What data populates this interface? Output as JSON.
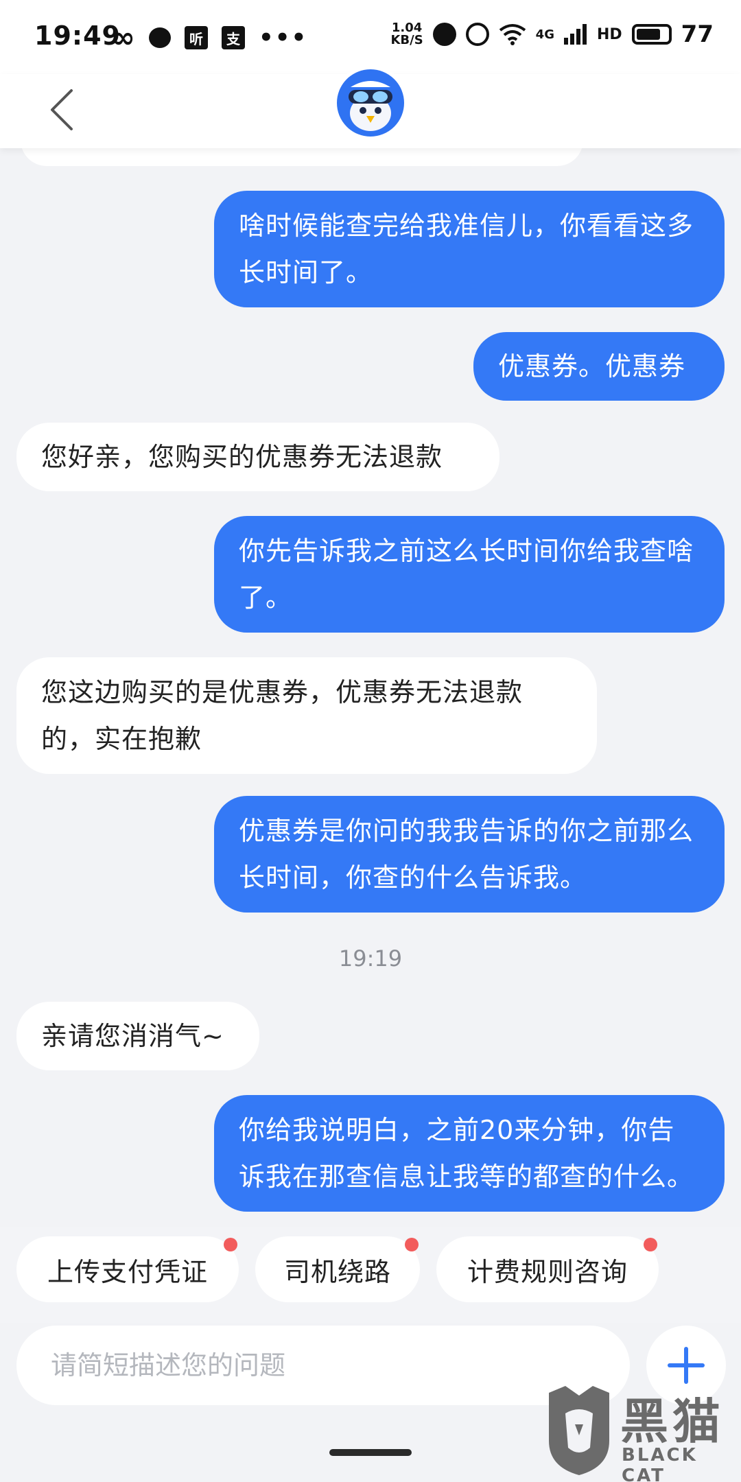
{
  "status_bar": {
    "time": "19:49",
    "left_icons": [
      "infinity-icon",
      "chat-bubble-icon",
      "ting-app-icon",
      "app-icon",
      "more-dots-icon"
    ],
    "ting_label": "听",
    "app_label": "支",
    "more_label": "•••",
    "net_speed_value": "1.04",
    "net_speed_unit": "KB/S",
    "signal_label": "4G",
    "hd_label": "HD",
    "battery": "77"
  },
  "nav": {
    "back_icon": "chevron-left-icon",
    "avatar_icon": "penguin-mascot-avatar"
  },
  "chat": {
    "messages": [
      {
        "role": "user",
        "text": "啥时候能查完给我准信儿，你看看这多长时间了。"
      },
      {
        "role": "user",
        "text": "优惠券。优惠券"
      },
      {
        "role": "agent",
        "text": "您好亲，您购买的优惠券无法退款"
      },
      {
        "role": "user",
        "text": "你先告诉我之前这么长时间你给我查啥了。"
      },
      {
        "role": "agent",
        "text": "您这边购买的是优惠券，优惠券无法退款的，实在抱歉"
      },
      {
        "role": "user",
        "text": "优惠券是你问的我我告诉的你之前那么长时间，你查的什么告诉我。"
      },
      {
        "role": "timestamp",
        "text": "19:19"
      },
      {
        "role": "agent",
        "text": "亲请您消消气~"
      },
      {
        "role": "user",
        "text": "你给我说明白，之前20来分钟，你告诉我在那查信息让我等的都查的什么。"
      }
    ]
  },
  "quick_replies": [
    {
      "label": "上传支付凭证",
      "badge": true
    },
    {
      "label": "司机绕路",
      "badge": true
    },
    {
      "label": "计费规则咨询",
      "badge": true
    }
  ],
  "input": {
    "placeholder": "请简短描述您的问题",
    "value": "",
    "plus_icon": "plus-icon"
  },
  "watermark": {
    "cn": "黑猫",
    "en": "BLACK CAT",
    "icon": "black-cat-logo"
  },
  "colors": {
    "accent": "#3479f6",
    "background": "#f2f3f6",
    "badge": "#f25c5c"
  }
}
